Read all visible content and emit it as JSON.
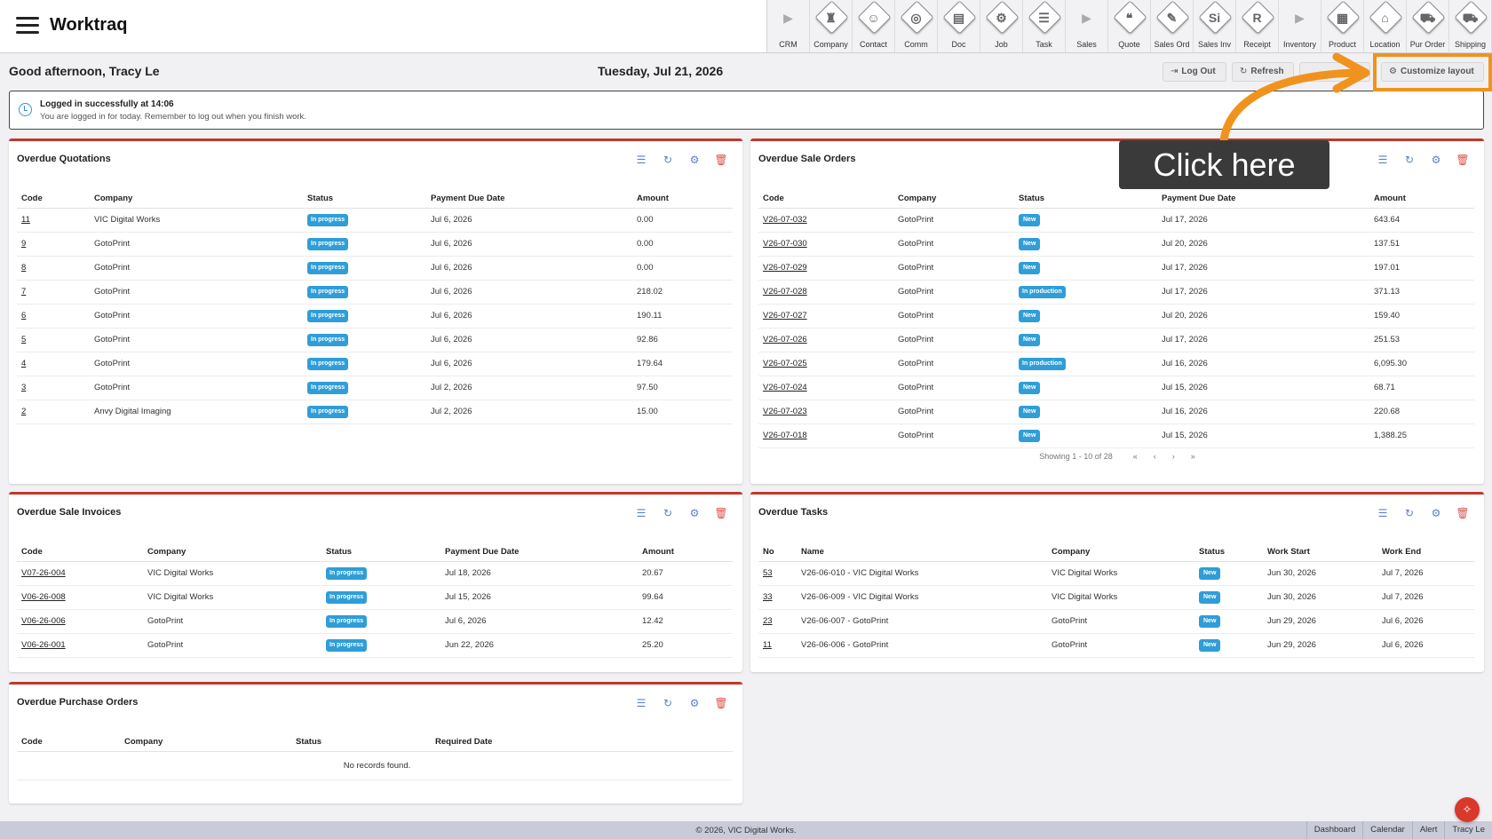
{
  "app": {
    "title": "Worktraq"
  },
  "modules": [
    {
      "label": "CRM",
      "glyph": "▶",
      "arrow": true
    },
    {
      "label": "Company",
      "glyph": "♜"
    },
    {
      "label": "Contact",
      "glyph": "☺"
    },
    {
      "label": "Comm",
      "glyph": "◎"
    },
    {
      "label": "Doc",
      "glyph": "▤"
    },
    {
      "label": "Job",
      "glyph": "⚙"
    },
    {
      "label": "Task",
      "glyph": "☰"
    },
    {
      "label": "Sales",
      "glyph": "▶",
      "arrow": true
    },
    {
      "label": "Quote",
      "glyph": "❝"
    },
    {
      "label": "Sales Ord",
      "glyph": "✎"
    },
    {
      "label": "Sales Inv",
      "glyph": "Si"
    },
    {
      "label": "Receipt",
      "glyph": "R"
    },
    {
      "label": "Inventory",
      "glyph": "▶",
      "arrow": true
    },
    {
      "label": "Product",
      "glyph": "▦"
    },
    {
      "label": "Location",
      "glyph": "⌂"
    },
    {
      "label": "Pur Order",
      "glyph": "⛟"
    },
    {
      "label": "Shipping",
      "glyph": "⛟"
    }
  ],
  "header": {
    "greeting": "Good afternoon, Tracy Le",
    "date": "Tuesday, Jul 21, 2026",
    "logout": "Log Out",
    "refresh": "Refresh",
    "customize": "Customize layout"
  },
  "banner": {
    "title": "Logged in successfully at 14:06",
    "text": "You are logged in for today. Remember to log out when you finish work."
  },
  "quotations": {
    "title": "Overdue Quotations",
    "columns": [
      "Code",
      "Company",
      "Status",
      "Payment Due Date",
      "Amount"
    ],
    "rows": [
      [
        "11",
        "VIC Digital Works",
        "In progress",
        "Jul 6, 2026",
        "0.00"
      ],
      [
        "9",
        "GotoPrint",
        "In progress",
        "Jul 6, 2026",
        "0.00"
      ],
      [
        "8",
        "GotoPrint",
        "In progress",
        "Jul 6, 2026",
        "0.00"
      ],
      [
        "7",
        "GotoPrint",
        "In progress",
        "Jul 6, 2026",
        "218.02"
      ],
      [
        "6",
        "GotoPrint",
        "In progress",
        "Jul 6, 2026",
        "190.11"
      ],
      [
        "5",
        "GotoPrint",
        "In progress",
        "Jul 6, 2026",
        "92.86"
      ],
      [
        "4",
        "GotoPrint",
        "In progress",
        "Jul 6, 2026",
        "179.64"
      ],
      [
        "3",
        "GotoPrint",
        "In progress",
        "Jul 2, 2026",
        "97.50"
      ],
      [
        "2",
        "Anvy Digital Imaging",
        "In progress",
        "Jul 2, 2026",
        "15.00"
      ]
    ]
  },
  "sale_orders": {
    "title": "Overdue Sale Orders",
    "columns": [
      "Code",
      "Company",
      "Status",
      "Payment Due Date",
      "Amount"
    ],
    "rows": [
      [
        "V26-07-032",
        "GotoPrint",
        "New",
        "Jul 17, 2026",
        "643.64"
      ],
      [
        "V26-07-030",
        "GotoPrint",
        "New",
        "Jul 20, 2026",
        "137.51"
      ],
      [
        "V26-07-029",
        "GotoPrint",
        "New",
        "Jul 17, 2026",
        "197.01"
      ],
      [
        "V26-07-028",
        "GotoPrint",
        "In production",
        "Jul 17, 2026",
        "371.13"
      ],
      [
        "V26-07-027",
        "GotoPrint",
        "New",
        "Jul 20, 2026",
        "159.40"
      ],
      [
        "V26-07-026",
        "GotoPrint",
        "New",
        "Jul 17, 2026",
        "251.53"
      ],
      [
        "V26-07-025",
        "GotoPrint",
        "In production",
        "Jul 16, 2026",
        "6,095.30"
      ],
      [
        "V26-07-024",
        "GotoPrint",
        "New",
        "Jul 15, 2026",
        "68.71"
      ],
      [
        "V26-07-023",
        "GotoPrint",
        "New",
        "Jul 16, 2026",
        "220.68"
      ],
      [
        "V26-07-018",
        "GotoPrint",
        "New",
        "Jul 15, 2026",
        "1,388.25"
      ]
    ],
    "pager": {
      "info": "Showing 1 - 10 of 28",
      "first": "«",
      "prev": "‹",
      "next": "›",
      "last": "»"
    }
  },
  "sale_invoices": {
    "title": "Overdue Sale Invoices",
    "columns": [
      "Code",
      "Company",
      "Status",
      "Payment Due Date",
      "Amount"
    ],
    "rows": [
      [
        "V07-26-004",
        "VIC Digital Works",
        "In progress",
        "Jul 18, 2026",
        "20.67"
      ],
      [
        "V06-26-008",
        "VIC Digital Works",
        "In progress",
        "Jul 15, 2026",
        "99.64"
      ],
      [
        "V06-26-006",
        "GotoPrint",
        "In progress",
        "Jul 6, 2026",
        "12.42"
      ],
      [
        "V06-26-001",
        "GotoPrint",
        "In progress",
        "Jun 22, 2026",
        "25.20"
      ]
    ]
  },
  "tasks": {
    "title": "Overdue Tasks",
    "columns": [
      "No",
      "Name",
      "Company",
      "Status",
      "Work Start",
      "Work End"
    ],
    "rows": [
      [
        "53",
        "V26-06-010 - VIC Digital Works",
        "VIC Digital Works",
        "New",
        "Jun 30, 2026",
        "Jul 7, 2026"
      ],
      [
        "33",
        "V26-06-009 - VIC Digital Works",
        "VIC Digital Works",
        "New",
        "Jun 30, 2026",
        "Jul 7, 2026"
      ],
      [
        "23",
        "V26-06-007 - GotoPrint",
        "GotoPrint",
        "New",
        "Jun 29, 2026",
        "Jul 6, 2026"
      ],
      [
        "11",
        "V26-06-006 - GotoPrint",
        "GotoPrint",
        "New",
        "Jun 29, 2026",
        "Jul 6, 2026"
      ]
    ]
  },
  "purchase_orders": {
    "title": "Overdue Purchase Orders",
    "columns": [
      "Code",
      "Company",
      "Status",
      "Required Date"
    ],
    "empty": "No records found."
  },
  "footer": {
    "copyright": "© 2026, VIC Digital Works.",
    "links": [
      "Dashboard",
      "Calendar",
      "Alert",
      "Tracy Le"
    ]
  },
  "annotation": {
    "label": "Click here",
    "color": "#f0931e"
  },
  "colors": {
    "accent_red": "#c0392b",
    "badge_blue": "#2f9ed8",
    "icon_blue": "#5b7fc7"
  }
}
